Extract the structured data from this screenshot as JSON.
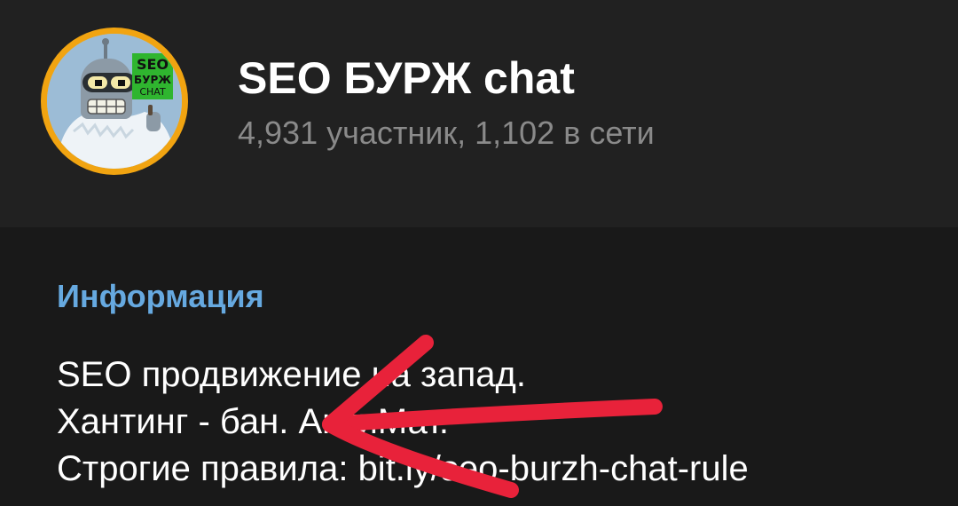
{
  "header": {
    "title": "SEO БУРЖ chat",
    "subtitle": "4,931 участник, 1,102 в сети",
    "avatar": {
      "badge_line1": "SEO",
      "badge_line2": "БУРЖ",
      "badge_line3": "CHAT"
    }
  },
  "info": {
    "section_title": "Информация",
    "line1": "SEO продвижение на запад.",
    "line2": "Хантинг - бан. АнтиМат.",
    "line3_prefix": "Строгие правила: ",
    "line3_link": "bit.ly/seo-burzh-chat-rule"
  },
  "colors": {
    "background": "#191919",
    "header_background": "#212121",
    "accent": "#66a9e0",
    "avatar_ring": "#f1a411",
    "arrow": "#e8223a",
    "badge": "#2fb52f"
  }
}
